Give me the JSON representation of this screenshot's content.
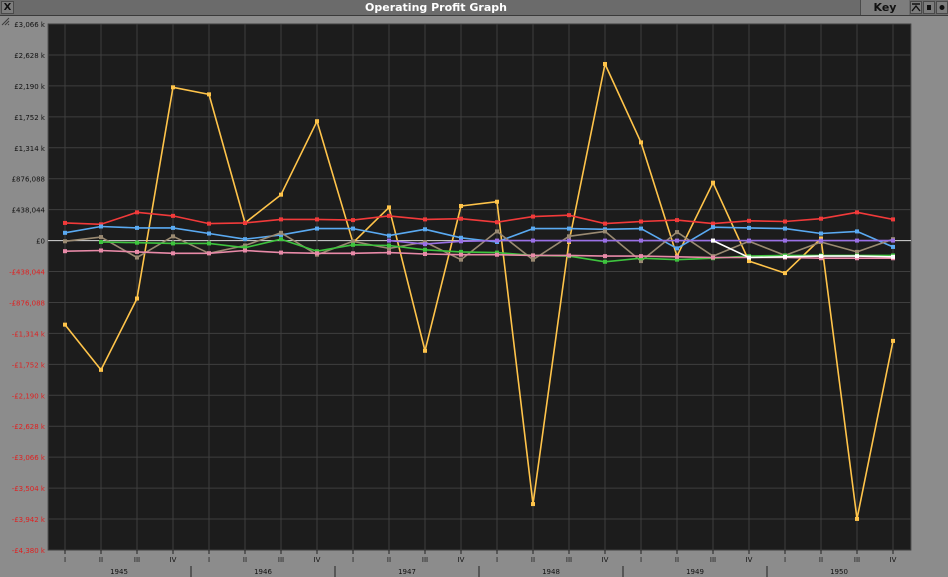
{
  "window": {
    "title": "Operating Profit Graph",
    "key_label": "Key",
    "close_glyph": "X"
  },
  "colors": {
    "plot_bg": "#1c1c1c",
    "grid": "#3e3e3e",
    "pos_label": "#111111",
    "neg_label": "#e02020",
    "zero_line": "#d8d8d8"
  },
  "chart_data": {
    "type": "line",
    "ylim": [
      -4380,
      3066
    ],
    "y_ticks": [
      {
        "value": 3066,
        "label": "£3,066 k"
      },
      {
        "value": 2628,
        "label": "£2,628 k"
      },
      {
        "value": 2190,
        "label": "£2,190 k"
      },
      {
        "value": 1752,
        "label": "£1,752 k"
      },
      {
        "value": 1314,
        "label": "£1,314 k"
      },
      {
        "value": 876,
        "label": "£876,088"
      },
      {
        "value": 438,
        "label": "£438,044"
      },
      {
        "value": 0,
        "label": "£0"
      },
      {
        "value": -438,
        "label": "-£438,044"
      },
      {
        "value": -876,
        "label": "-£876,088"
      },
      {
        "value": -1314,
        "label": "-£1,314 k"
      },
      {
        "value": -1752,
        "label": "-£1,752 k"
      },
      {
        "value": -2190,
        "label": "-£2,190 k"
      },
      {
        "value": -2628,
        "label": "-£2,628 k"
      },
      {
        "value": -3066,
        "label": "-£3,066 k"
      },
      {
        "value": -3504,
        "label": "-£3,504 k"
      },
      {
        "value": -3942,
        "label": "-£3,942 k"
      },
      {
        "value": -4380,
        "label": "-£4,380 k"
      }
    ],
    "quarter_labels": [
      "I",
      "II",
      "III",
      "IV",
      "I",
      "II",
      "III",
      "IV",
      "I",
      "II",
      "III",
      "IV",
      "I",
      "II",
      "III",
      "IV",
      "I",
      "II",
      "III",
      "IV",
      "I",
      "II",
      "III",
      "IV"
    ],
    "years": [
      "1945",
      "1946",
      "1947",
      "1948",
      "1949",
      "1950"
    ],
    "series": [
      {
        "color": "#ffc44a",
        "values": [
          -1190,
          -1830,
          -820,
          2170,
          2070,
          250,
          650,
          1690,
          -30,
          470,
          -1560,
          490,
          550,
          -3730,
          -20,
          2500,
          1390,
          -220,
          820,
          -290,
          -460,
          30,
          -3940,
          -1420
        ]
      },
      {
        "color": "#f23a3a",
        "values": [
          250,
          230,
          400,
          350,
          240,
          250,
          300,
          300,
          290,
          350,
          300,
          310,
          260,
          340,
          360,
          240,
          270,
          290,
          240,
          280,
          270,
          310,
          400,
          300
        ]
      },
      {
        "color": "#5aaaf2",
        "values": [
          110,
          200,
          180,
          180,
          100,
          20,
          80,
          170,
          170,
          70,
          160,
          40,
          -20,
          170,
          170,
          160,
          170,
          -110,
          190,
          180,
          170,
          100,
          130,
          -90
        ]
      },
      {
        "color": "#9a8a72",
        "values": [
          -10,
          50,
          -240,
          60,
          -180,
          -70,
          110,
          -200,
          -10,
          -110,
          -20,
          -270,
          130,
          -270,
          60,
          130,
          -290,
          120,
          -220,
          -10,
          -210,
          -20,
          -160,
          20
        ]
      },
      {
        "color": "#3ec43e",
        "values": [
          null,
          -20,
          -30,
          -40,
          -40,
          -100,
          20,
          -150,
          -60,
          -70,
          -130,
          -160,
          -170,
          -210,
          -220,
          -300,
          -250,
          -270,
          -250,
          -220,
          -210,
          -210,
          -210,
          -210
        ]
      },
      {
        "color": "#e88aa8",
        "values": [
          -150,
          -140,
          -160,
          -180,
          -180,
          -140,
          -170,
          -180,
          -180,
          -170,
          -190,
          -200,
          -200,
          -210,
          -210,
          -220,
          -220,
          -230,
          -240,
          -240,
          -240,
          -250,
          -250,
          -250
        ]
      },
      {
        "color": "#9a70e6",
        "values": [
          null,
          null,
          null,
          null,
          null,
          null,
          null,
          null,
          null,
          0,
          -50,
          -10,
          0,
          0,
          0,
          0,
          0,
          0,
          0,
          0,
          0,
          0,
          0,
          0
        ]
      },
      {
        "color": "#ffffff",
        "values": [
          null,
          null,
          null,
          null,
          null,
          null,
          null,
          null,
          null,
          null,
          null,
          null,
          null,
          null,
          null,
          null,
          null,
          null,
          0,
          -240,
          -230,
          -220,
          -220,
          -230
        ]
      }
    ]
  }
}
